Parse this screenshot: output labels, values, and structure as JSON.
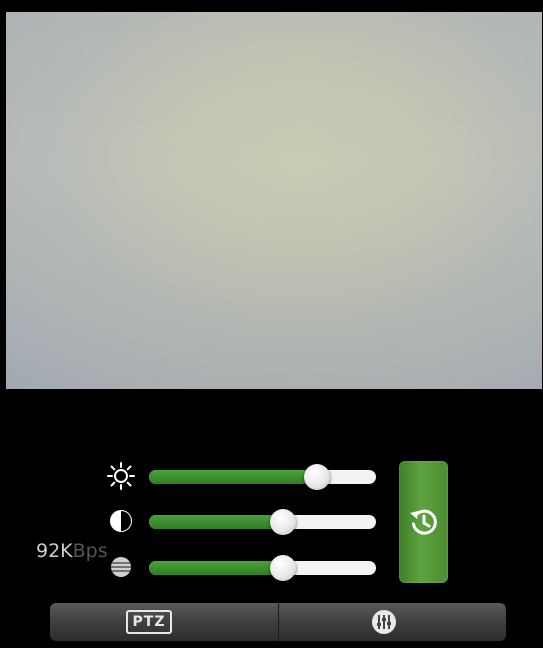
{
  "video": {
    "description_icon": "camera-feed"
  },
  "controls": {
    "brightness": {
      "icon": "sun-icon",
      "level": 0.74
    },
    "contrast": {
      "icon": "contrast-icon",
      "level": 0.59
    },
    "saturation": {
      "icon": "saturation-icon",
      "level": 0.59
    }
  },
  "bitrate": {
    "value": "92K",
    "unit": "Bps"
  },
  "reset": {
    "icon": "restore-clock-icon"
  },
  "bottombar": {
    "ptz_label": "PTZ",
    "settings_icon": "equalizer-icon"
  },
  "colors": {
    "accent": "#3f8f2c",
    "track": "#f3f3f3"
  }
}
